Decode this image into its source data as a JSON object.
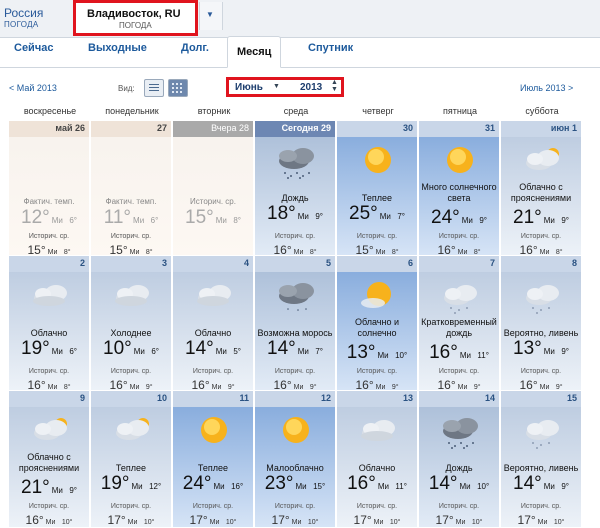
{
  "header": {
    "region_title": "Россия",
    "region_sub": "ПОГОДА",
    "city_title": "Владивосток, RU",
    "city_sub": "ПОГОДА"
  },
  "tabs": [
    {
      "label": "Сейчас",
      "active": false
    },
    {
      "label": "Выходные",
      "active": false
    },
    {
      "label": "Долг.",
      "active": false
    },
    {
      "label": "Месяц",
      "active": true
    },
    {
      "label": "Спутник",
      "active": false
    }
  ],
  "nav": {
    "prev": "< Май 2013",
    "next": "Июль 2013 >",
    "view_label": "Вид:",
    "month": "Июнь",
    "year": "2013"
  },
  "weekdays": [
    "воскресенье",
    "понедельник",
    "вторник",
    "среда",
    "четверг",
    "пятница",
    "суббота"
  ],
  "labels": {
    "fact": "Фактич. темп.",
    "hist": "Историч. ср.",
    "min": "Ми"
  },
  "days": [
    {
      "date": "май 26",
      "type": "past",
      "head": "pastbar",
      "desc": "",
      "hi": "12°",
      "lo": "6°",
      "hist_hi": "15°",
      "hist_lo": "8°",
      "icon": "none"
    },
    {
      "date": "27",
      "type": "past",
      "head": "pastbar",
      "desc": "",
      "hi": "11°",
      "lo": "6°",
      "hist_hi": "15°",
      "hist_lo": "8°",
      "icon": "none"
    },
    {
      "date": "Вчера 28",
      "type": "past",
      "head": "gray",
      "desc": "",
      "hi": "15°",
      "lo": "8°",
      "hist_hi": "",
      "hist_lo": "",
      "icon": "none"
    },
    {
      "date": "Сегодня 29",
      "type": "rain",
      "head": "today",
      "desc": "Дождь",
      "hi": "18°",
      "lo": "9°",
      "hist_hi": "16°",
      "hist_lo": "8°",
      "icon": "rain-cloud-icon"
    },
    {
      "date": "30",
      "type": "sun",
      "head": "blue",
      "desc": "Теплее",
      "hi": "25°",
      "lo": "7°",
      "hist_hi": "15°",
      "hist_lo": "8°",
      "icon": "sun-icon"
    },
    {
      "date": "31",
      "type": "sun",
      "head": "blue",
      "desc": "Много солнечного света",
      "hi": "24°",
      "lo": "9°",
      "hist_hi": "16°",
      "hist_lo": "8°",
      "icon": "sun-icon"
    },
    {
      "date": "июн 1",
      "type": "cloud",
      "head": "blue",
      "desc": "Облачно с прояснениями",
      "hi": "21°",
      "lo": "9°",
      "hist_hi": "16°",
      "hist_lo": "8°",
      "icon": "partly-cloudy-icon"
    },
    {
      "date": "2",
      "type": "cloud",
      "head": "blue",
      "desc": "Облачно",
      "hi": "19°",
      "lo": "6°",
      "hist_hi": "16°",
      "hist_lo": "8°",
      "icon": "cloud-icon"
    },
    {
      "date": "3",
      "type": "cloud",
      "head": "blue",
      "desc": "Холоднее",
      "hi": "10°",
      "lo": "6°",
      "hist_hi": "16°",
      "hist_lo": "9°",
      "icon": "cloud-icon"
    },
    {
      "date": "4",
      "type": "cloud",
      "head": "blue",
      "desc": "Облачно",
      "hi": "14°",
      "lo": "5°",
      "hist_hi": "16°",
      "hist_lo": "9°",
      "icon": "cloud-icon"
    },
    {
      "date": "5",
      "type": "rain",
      "head": "blue",
      "desc": "Возможна морось",
      "hi": "14°",
      "lo": "7°",
      "hist_hi": "16°",
      "hist_lo": "9°",
      "icon": "drizzle-icon"
    },
    {
      "date": "6",
      "type": "sun",
      "head": "blue",
      "desc": "Облачно и солнечно",
      "hi": "13°",
      "lo": "10°",
      "hist_hi": "16°",
      "hist_lo": "9°",
      "icon": "sun-cloud-icon"
    },
    {
      "date": "7",
      "type": "cloud",
      "head": "blue",
      "desc": "Кратковременный дождь",
      "hi": "16°",
      "lo": "11°",
      "hist_hi": "16°",
      "hist_lo": "9°",
      "icon": "showers-icon"
    },
    {
      "date": "8",
      "type": "cloud",
      "head": "blue",
      "desc": "Вероятно, ливень",
      "hi": "13°",
      "lo": "9°",
      "hist_hi": "16°",
      "hist_lo": "9°",
      "icon": "showers-icon"
    },
    {
      "date": "9",
      "type": "cloud",
      "head": "blue",
      "desc": "Облачно с прояснениями",
      "hi": "21°",
      "lo": "9°",
      "hist_hi": "16°",
      "hist_lo": "10°",
      "icon": "partly-cloudy-icon"
    },
    {
      "date": "10",
      "type": "cloud",
      "head": "blue",
      "desc": "Теплее",
      "hi": "19°",
      "lo": "12°",
      "hist_hi": "17°",
      "hist_lo": "10°",
      "icon": "partly-cloudy-icon"
    },
    {
      "date": "11",
      "type": "sun",
      "head": "blue",
      "desc": "Теплее",
      "hi": "24°",
      "lo": "16°",
      "hist_hi": "17°",
      "hist_lo": "10°",
      "icon": "sun-icon"
    },
    {
      "date": "12",
      "type": "sun",
      "head": "blue",
      "desc": "Малооблачно",
      "hi": "23°",
      "lo": "15°",
      "hist_hi": "17°",
      "hist_lo": "10°",
      "icon": "sun-icon"
    },
    {
      "date": "13",
      "type": "cloud",
      "head": "blue",
      "desc": "Облачно",
      "hi": "16°",
      "lo": "11°",
      "hist_hi": "17°",
      "hist_lo": "10°",
      "icon": "cloud-icon"
    },
    {
      "date": "14",
      "type": "rain",
      "head": "blue",
      "desc": "Дождь",
      "hi": "14°",
      "lo": "10°",
      "hist_hi": "17°",
      "hist_lo": "10°",
      "icon": "rain-cloud-icon"
    },
    {
      "date": "15",
      "type": "cloud",
      "head": "blue",
      "desc": "Вероятно, ливень",
      "hi": "14°",
      "lo": "9°",
      "hist_hi": "17°",
      "hist_lo": "10°",
      "icon": "showers-icon"
    }
  ]
}
